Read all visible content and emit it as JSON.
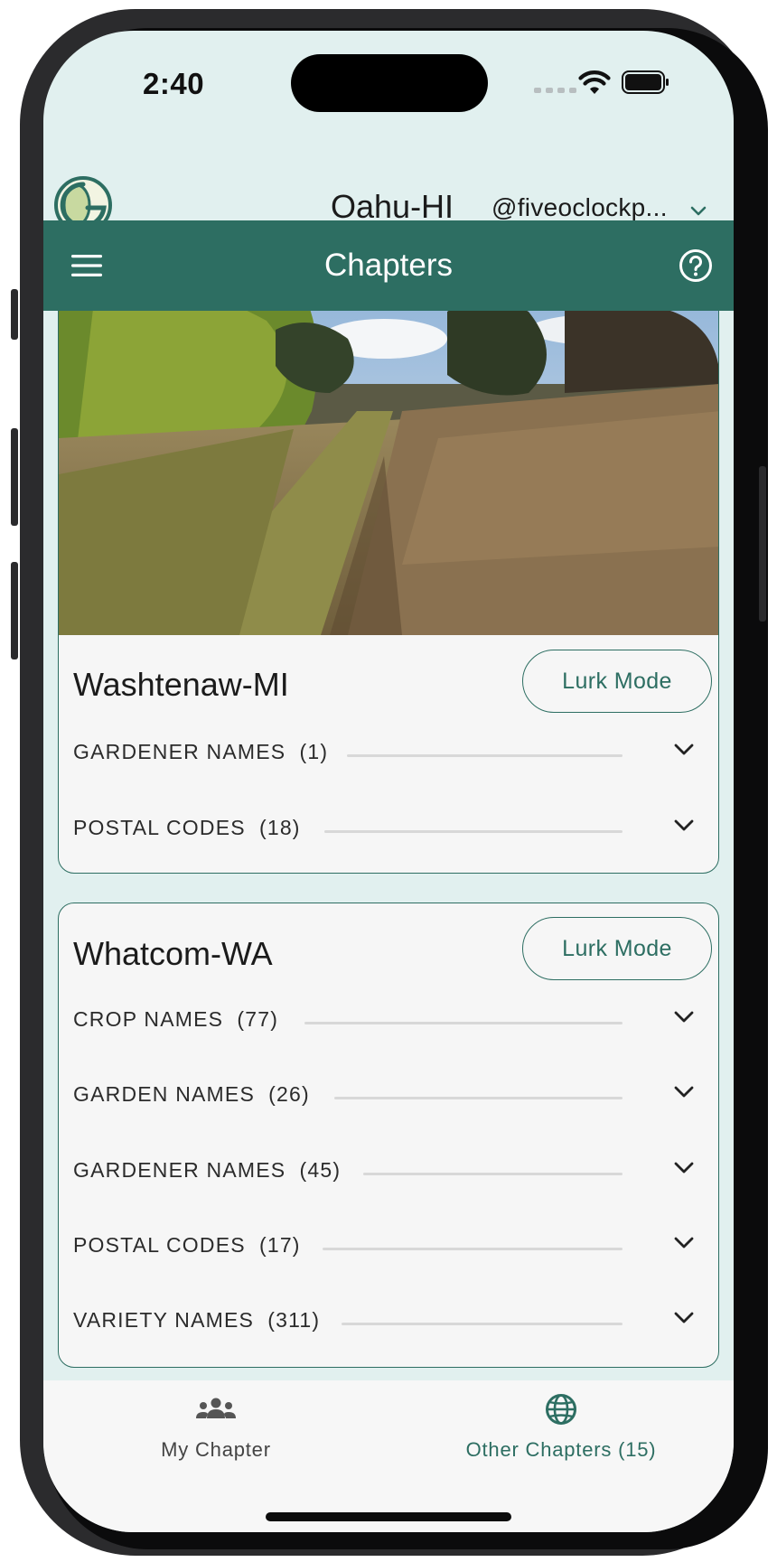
{
  "status_bar": {
    "time": "2:40"
  },
  "header": {
    "chapter": "Oahu-HI",
    "user_handle": "@fiveoclockp..."
  },
  "toolbar": {
    "title": "Chapters"
  },
  "cards": [
    {
      "name": "Washtenaw-MI",
      "lurk_label": "Lurk Mode",
      "sections": [
        {
          "label": "GARDENER NAMES",
          "count": "(1)"
        },
        {
          "label": "POSTAL CODES",
          "count": "(18)"
        }
      ]
    },
    {
      "name": "Whatcom-WA",
      "lurk_label": "Lurk Mode",
      "sections": [
        {
          "label": "CROP NAMES",
          "count": "(77)"
        },
        {
          "label": "GARDEN NAMES",
          "count": "(26)"
        },
        {
          "label": "GARDENER NAMES",
          "count": "(45)"
        },
        {
          "label": "POSTAL CODES",
          "count": "(17)"
        },
        {
          "label": "VARIETY NAMES",
          "count": "(311)"
        }
      ]
    }
  ],
  "bottom_nav": {
    "my_chapter": "My Chapter",
    "other_chapters": "Other Chapters (15)"
  },
  "icons": {
    "menu": "hamburger-menu-icon",
    "help": "question-circle-icon",
    "expand": "chevron-down-icon",
    "my_chapter": "people-group-icon",
    "other_chapters": "globe-icon"
  },
  "colors": {
    "primary": "#2d6e62",
    "background": "#e1f0ef",
    "card": "#f6f6f6"
  }
}
